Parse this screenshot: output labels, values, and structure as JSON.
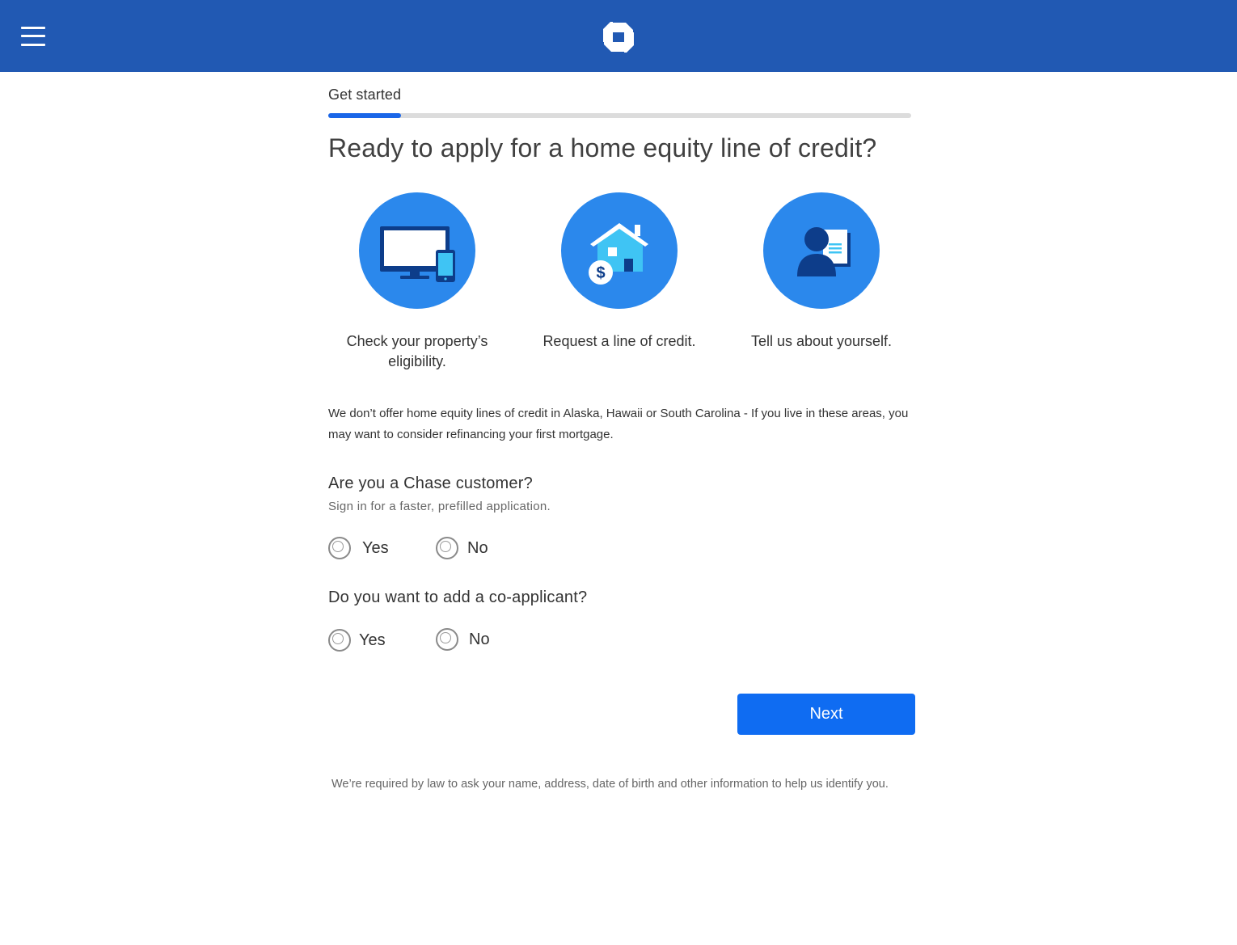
{
  "header": {
    "menu_icon": "hamburger-menu-icon",
    "logo_icon": "chase-octagon-logo",
    "brand_color": "#2159b3"
  },
  "progress": {
    "label": "Get started",
    "fraction": 0.125,
    "fill_color": "#1a66e8"
  },
  "page": {
    "title": "Ready to apply for a home equity line of credit?"
  },
  "steps": [
    {
      "icon": "computer-and-phone-icon",
      "text": "Check your property’s eligibility."
    },
    {
      "icon": "house-with-dollar-icon",
      "text": "Request a line of credit."
    },
    {
      "icon": "person-with-document-icon",
      "text": "Tell us about yourself."
    }
  ],
  "notice": "We don’t offer home equity lines of credit in Alaska, Hawaii or South Carolina - If you live in these areas, you may want to consider refinancing your first mortgage.",
  "questions": {
    "customer": {
      "label": "Are you a Chase customer?",
      "sub": "Sign in for a faster, prefilled application.",
      "yes": "Yes",
      "no": "No"
    },
    "coapplicant": {
      "label": "Do you want to add a co-applicant?",
      "yes": "Yes",
      "no": "No"
    }
  },
  "actions": {
    "next_label": "Next",
    "button_color": "#0f6cf2"
  },
  "footer": {
    "note": "We’re required by law to ask your name, address, date of birth and other information to help us identify you."
  }
}
